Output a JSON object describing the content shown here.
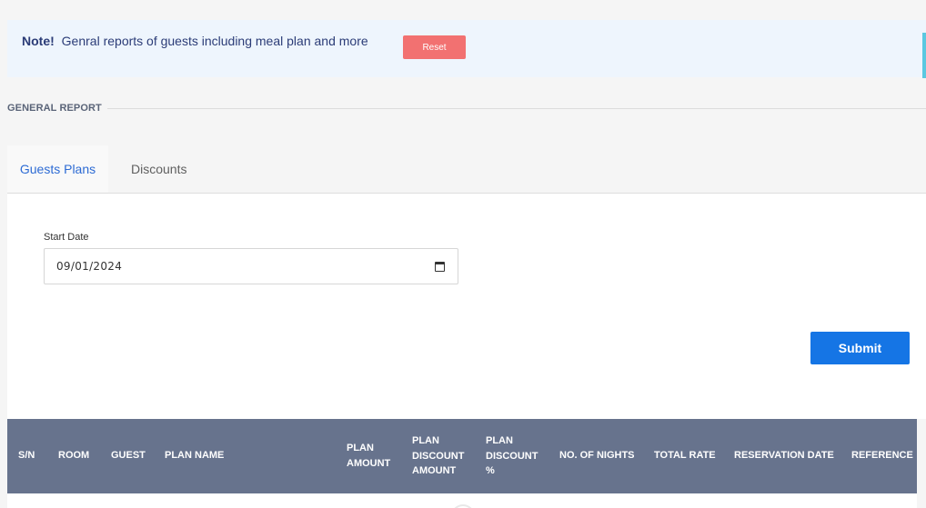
{
  "note": {
    "label": "Note!",
    "text": "Genral reports of guests including meal plan and more",
    "reset_label": "Reset"
  },
  "section": {
    "title": "GENERAL REPORT"
  },
  "tabs": [
    {
      "label": "Guests Plans",
      "active": true
    },
    {
      "label": "Discounts",
      "active": false
    }
  ],
  "form": {
    "start_date_label": "Start Date",
    "start_date_value": "09/01/2024",
    "submit_label": "Submit"
  },
  "table": {
    "headers": [
      "S/N",
      "ROOM",
      "GUEST",
      "PLAN NAME",
      "PLAN\nAMOUNT",
      "PLAN\nDISCOUNT\nAMOUNT",
      "PLAN\nDISCOUNT\n%",
      "NO. OF NIGHTS",
      "TOTAL RATE",
      "RESERVATION DATE",
      "REFERENCE"
    ]
  },
  "colors": {
    "accent": "#1575e5",
    "reset": "#f27171",
    "table_header": "#67738d",
    "active_tab": "#2d6bd4"
  }
}
